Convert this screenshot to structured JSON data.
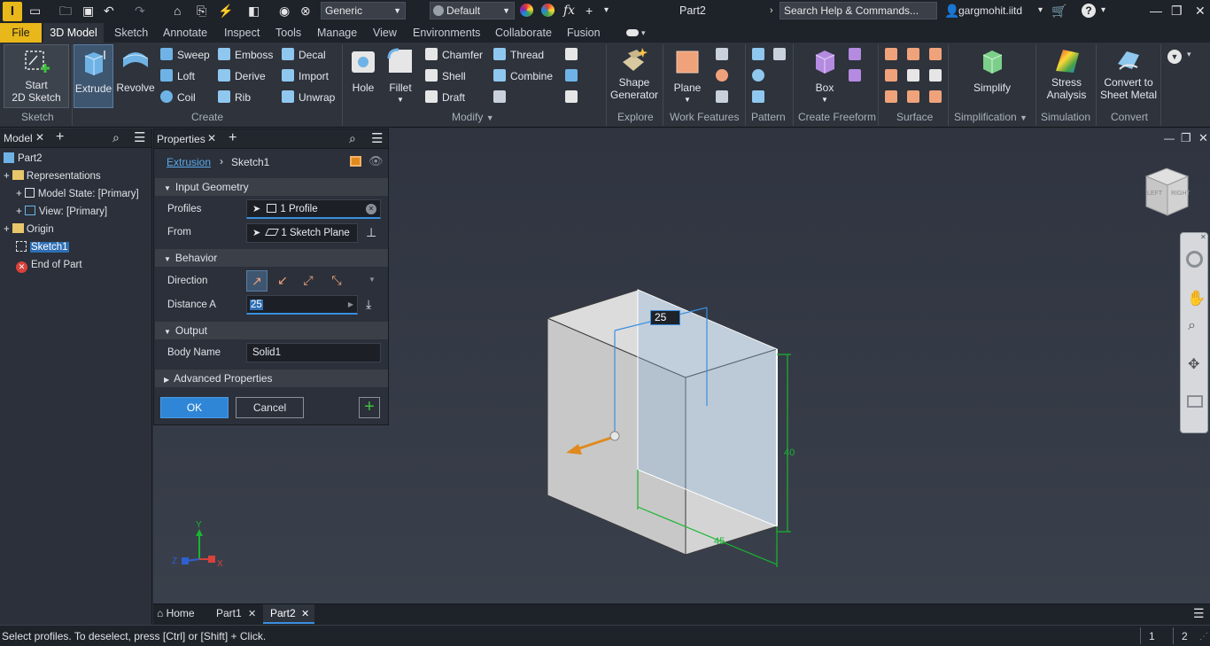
{
  "app": {
    "logo": "I",
    "doc_title": "Part2"
  },
  "qat": {
    "appearance": "Generic",
    "material": "Default",
    "search_placeholder": "Search Help & Commands...",
    "user": "gargmohit.iitd"
  },
  "tabs": [
    "File",
    "3D Model",
    "Sketch",
    "Annotate",
    "Inspect",
    "Tools",
    "Manage",
    "View",
    "Environments",
    "Collaborate",
    "Fusion"
  ],
  "ribbon": {
    "sketch": {
      "start_line1": "Start",
      "start_line2": "2D Sketch",
      "panel": "Sketch"
    },
    "create": {
      "extrude": "Extrude",
      "revolve": "Revolve",
      "sweep": "Sweep",
      "loft": "Loft",
      "coil": "Coil",
      "emboss": "Emboss",
      "derive": "Derive",
      "rib": "Rib",
      "decal": "Decal",
      "import": "Import",
      "unwrap": "Unwrap",
      "panel": "Create"
    },
    "modify": {
      "hole": "Hole",
      "fillet": "Fillet",
      "chamfer": "Chamfer",
      "shell": "Shell",
      "draft": "Draft",
      "thread": "Thread",
      "combine": "Combine",
      "panel": "Modify"
    },
    "explore": {
      "line1": "Shape",
      "line2": "Generator",
      "panel": "Explore"
    },
    "work": {
      "plane": "Plane",
      "panel": "Work Features"
    },
    "pattern": {
      "panel": "Pattern"
    },
    "freeform": {
      "box": "Box",
      "panel": "Create Freeform"
    },
    "surface": {
      "panel": "Surface"
    },
    "simplification": {
      "simplify": "Simplify",
      "panel": "Simplification"
    },
    "simulation": {
      "line1": "Stress",
      "line2": "Analysis",
      "panel": "Simulation"
    },
    "convert": {
      "line1": "Convert to",
      "line2": "Sheet Metal",
      "panel": "Convert"
    }
  },
  "model_panel": {
    "tab": "Model",
    "tree": [
      "Part2",
      "Representations",
      "Model State: [Primary]",
      "View: [Primary]",
      "Origin",
      "Sketch1",
      "End of Part"
    ]
  },
  "properties": {
    "tab": "Properties",
    "breadcrumb_link": "Extrusion",
    "breadcrumb_current": "Sketch1",
    "input_geometry": "Input Geometry",
    "profiles_label": "Profiles",
    "profiles_value": "1 Profile",
    "from_label": "From",
    "from_value": "1 Sketch Plane",
    "behavior": "Behavior",
    "direction_label": "Direction",
    "distance_label": "Distance A",
    "distance_value": "25",
    "output": "Output",
    "body_name_label": "Body Name",
    "body_name_value": "Solid1",
    "advanced": "Advanced Properties",
    "ok": "OK",
    "cancel": "Cancel"
  },
  "viewport": {
    "dim_depth": "25",
    "dim_height": "40",
    "dim_width": "45",
    "viewcube_left": "LEFT",
    "viewcube_right": "RIGHT",
    "axis_x": "X",
    "axis_y": "Y",
    "axis_z": "Z"
  },
  "doc_tabs": {
    "home": "Home",
    "part1": "Part1",
    "part2": "Part2"
  },
  "status": {
    "message": "Select profiles. To deselect, press [Ctrl] or [Shift] + Click.",
    "count1": "1",
    "count2": "2"
  }
}
